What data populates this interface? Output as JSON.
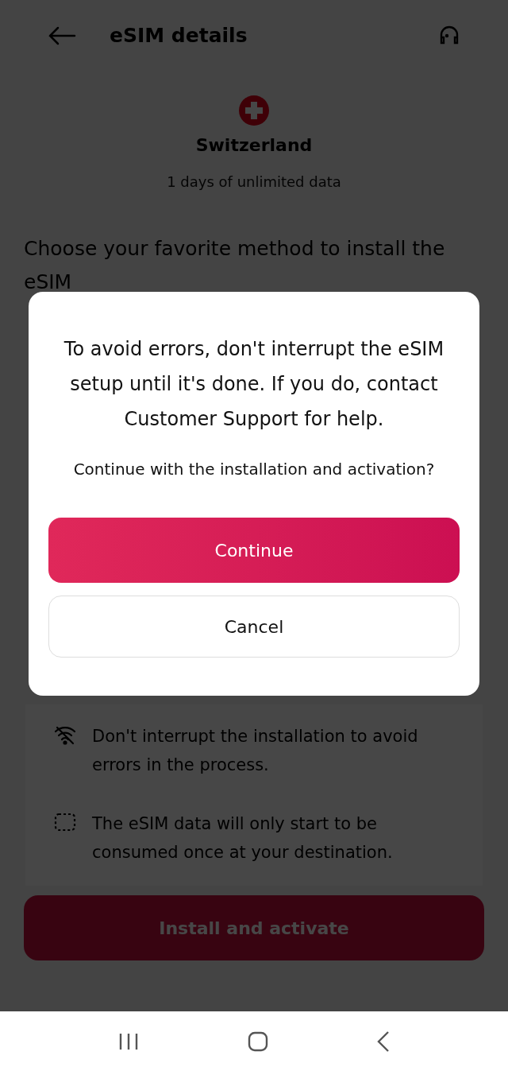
{
  "header": {
    "title": "eSIM details"
  },
  "destination": {
    "name": "Switzerland",
    "plan": "1 days of unlimited data"
  },
  "install_prompt": "Choose your favorite method to install the eSIM",
  "tips": [
    {
      "kind": "no-wifi",
      "text": "Don't interrupt the installation to avoid errors in the process."
    },
    {
      "kind": "dashed-frame",
      "text": "The eSIM data will only start to be consumed once at your destination."
    }
  ],
  "primary_button": "Install and activate",
  "dialog": {
    "message": "To avoid errors, don't interrupt the eSIM setup until it's done. If you do, contact Customer Support for help.",
    "question": "Continue with the installation and activation?",
    "buttons": [
      {
        "kind": "primary",
        "label": "Continue"
      },
      {
        "kind": "secondary",
        "label": "Cancel"
      }
    ]
  }
}
